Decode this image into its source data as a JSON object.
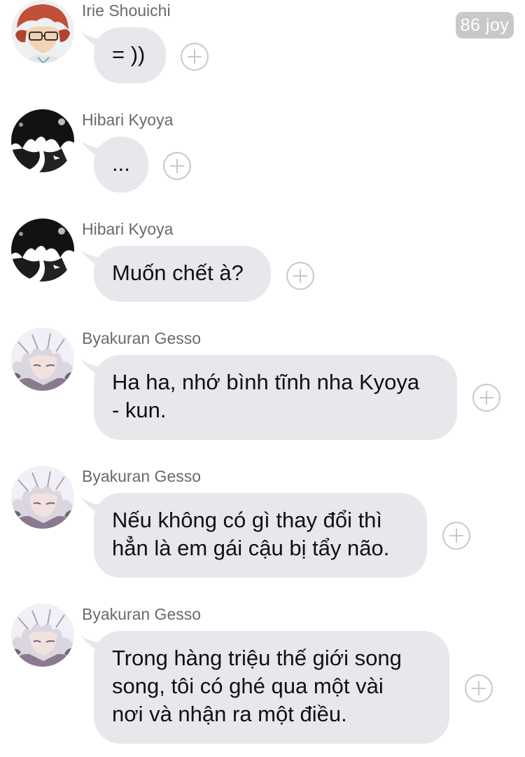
{
  "badge": {
    "text": "86 joy"
  },
  "messages": [
    {
      "sender": "Irie Shouichi",
      "avatar": "avatar-irie",
      "text": "= ))"
    },
    {
      "sender": "Hibari Kyoya",
      "avatar": "avatar-hibari",
      "text": "..."
    },
    {
      "sender": "Hibari Kyoya",
      "avatar": "avatar-hibari",
      "text": "Muốn chết à?"
    },
    {
      "sender": "Byakuran Gesso",
      "avatar": "avatar-byakuran",
      "text": "Ha ha, nhớ bình tĩnh nha Kyoya\n- kun."
    },
    {
      "sender": "Byakuran Gesso",
      "avatar": "avatar-byakuran",
      "text": "Nếu không có gì thay đổi thì\nhẳn là em gái cậu bị tẩy não."
    },
    {
      "sender": "Byakuran Gesso",
      "avatar": "avatar-byakuran",
      "text": "Trong hàng triệu thế giới song\nsong, tôi có ghé qua một vài\nnơi và nhận ra một điều."
    }
  ],
  "icons": {
    "add_reaction": "plus-circle-icon"
  },
  "colors": {
    "bubble": "#e6e8eb",
    "badge": "#c9c9c9",
    "sender_name": "#6a6a6a"
  }
}
